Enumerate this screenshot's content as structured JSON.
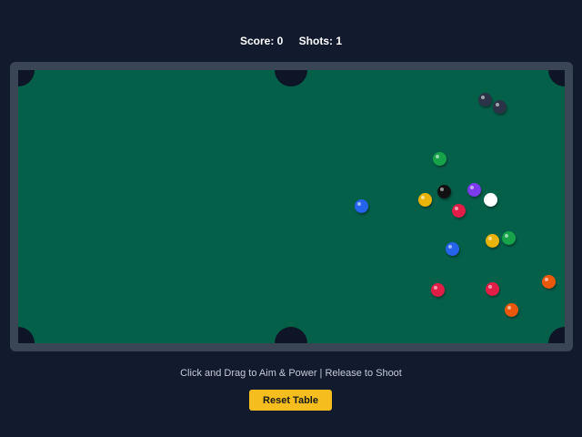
{
  "hud": {
    "score_text": "Score: 0",
    "shots_text": "Shots: 1"
  },
  "instructions": "Click and Drag to Aim & Power | Release to Shoot",
  "reset_button_label": "Reset Table",
  "colors": {
    "background": "#121a2e",
    "rail": "#3a4556",
    "felt": "#05604a",
    "pocket": "#0d1526",
    "button": "#f5be1e"
  },
  "balls": [
    {
      "name": "cue-ball",
      "color": "#ffffff"
    },
    {
      "name": "eight-ball",
      "color": "#111111"
    },
    {
      "name": "ball-blue-1",
      "color": "#2563eb"
    },
    {
      "name": "ball-green-1",
      "color": "#16a34a"
    },
    {
      "name": "ball-yellow-1",
      "color": "#eab308"
    },
    {
      "name": "ball-red-1",
      "color": "#e11d48"
    },
    {
      "name": "ball-purple",
      "color": "#7c3aed"
    },
    {
      "name": "ball-blue-2",
      "color": "#2563eb"
    },
    {
      "name": "ball-yellow-2",
      "color": "#eab308"
    },
    {
      "name": "ball-green-2",
      "color": "#16a34a"
    },
    {
      "name": "ball-orange-1",
      "color": "#ea580c"
    },
    {
      "name": "ball-red-2",
      "color": "#e11d48"
    },
    {
      "name": "ball-red-3",
      "color": "#e11d48"
    },
    {
      "name": "ball-orange-2",
      "color": "#ea580c"
    },
    {
      "name": "ball-dark-1",
      "color": "#2b3447"
    },
    {
      "name": "ball-dark-2",
      "color": "#2b3447"
    }
  ]
}
